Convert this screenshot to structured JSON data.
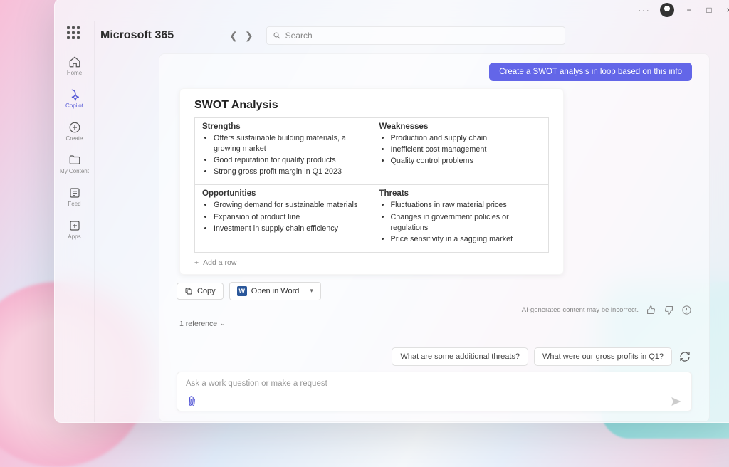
{
  "window": {
    "minimize": "−",
    "maximize": "□",
    "close": "×",
    "more": "···"
  },
  "brand": "Microsoft 365",
  "search": {
    "placeholder": "Search"
  },
  "rail": {
    "home": "Home",
    "copilot": "Copilot",
    "create": "Create",
    "mycontent": "My Content",
    "feed": "Feed",
    "apps": "Apps"
  },
  "chat": {
    "user_prompt": "Create a SWOT analysis in loop based on this info",
    "card_title": "SWOT Analysis",
    "quadrants": {
      "strengths": {
        "heading": "Strengths",
        "items": [
          "Offers sustainable building materials, a growing market",
          "Good reputation for quality products",
          "Strong gross profit margin in Q1 2023"
        ]
      },
      "weaknesses": {
        "heading": "Weaknesses",
        "items": [
          "Production and supply chain",
          "Inefficient cost management",
          "Quality control problems"
        ]
      },
      "opportunities": {
        "heading": "Opportunities",
        "items": [
          "Growing demand for sustainable materials",
          "Expansion of product line",
          "Investment in supply chain efficiency"
        ]
      },
      "threats": {
        "heading": "Threats",
        "items": [
          "Fluctuations in raw material prices",
          "Changes in government policies or regulations",
          "Price sensitivity in a sagging market"
        ]
      }
    },
    "add_row": "Add a row",
    "copy_label": "Copy",
    "open_word_label": "Open in Word",
    "disclaimer": "AI-generated content may be incorrect.",
    "references": "1 reference",
    "suggestions": [
      "What are some additional threats?",
      "What were our gross profits in Q1?"
    ],
    "input_placeholder": "Ask a work question or make a request"
  }
}
